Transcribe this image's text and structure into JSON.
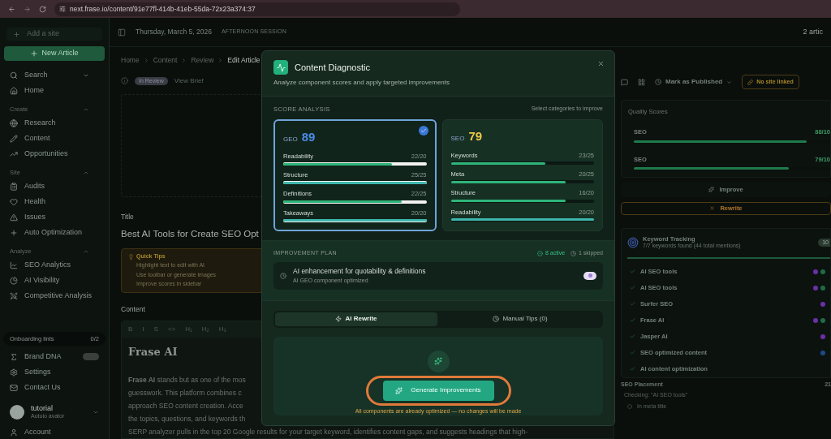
{
  "browser": {
    "url": "next.frase.io/content/91e77fl-414b-41eb-55da-72x23a374:37"
  },
  "sidebar": {
    "add_site": "Add a site",
    "new_article": "New Article",
    "search": "Search",
    "home": "Home",
    "sections": [
      {
        "title": "Create",
        "items": [
          {
            "label": "Research"
          },
          {
            "label": "Content"
          },
          {
            "label": "Opportunities"
          }
        ]
      },
      {
        "title": "Site",
        "items": [
          {
            "label": "Audits"
          },
          {
            "label": "Health"
          },
          {
            "label": "Issues"
          },
          {
            "label": "Auto Optimization"
          }
        ]
      },
      {
        "title": "Analyze",
        "items": [
          {
            "label": "SEO Analytics"
          },
          {
            "label": "AI Visibility"
          },
          {
            "label": "Competitive Analysis"
          }
        ]
      }
    ],
    "onboarding": {
      "label": "Onboarding lints",
      "count": "0/2"
    },
    "bottom_items": [
      {
        "label": "Brand DNA",
        "badge": true
      },
      {
        "label": "Settings",
        "badge": false
      },
      {
        "label": "Contact Us",
        "badge": false
      }
    ],
    "user": {
      "name": "tutorial",
      "subtitle": "Autuio avator"
    },
    "account": "Account"
  },
  "header": {
    "date": "Thursday, March 5, 2026",
    "session": "AFTERNOON SESSION",
    "count": "2 artic"
  },
  "breadcrumbs": [
    "Home",
    "Content",
    "Review",
    "Edit Article"
  ],
  "status": {
    "badge": "In Review",
    "link": "View Brief"
  },
  "title_field": {
    "label": "Title",
    "value": "Best AI Tools for Create SEO Opt"
  },
  "quick_tips": {
    "title": "Quick Tips",
    "tips": [
      "Highlight text to edit with AI",
      "Use toolbar or generate images",
      "Improve scores in sidebar"
    ]
  },
  "content": {
    "label": "Content",
    "toolbar": [
      "B",
      "I",
      "S",
      "<>",
      "H₁",
      "H₂",
      "H₃"
    ],
    "heading": "Frase AI",
    "lines": [
      "**Frase AI** stands but as one of the mos",
      "guesswork. This platform combines c",
      "approach SEO content creation. Acce",
      "the topics, questions, and keywords th"
    ],
    "last_line": "SERP analyzer pulls in the top 20 Google results for your target keyword, identifies content gaps, and suggests headings that high-"
  },
  "right_panel": {
    "publish": "Mark as Published",
    "site_link": "No site linked",
    "quality_title": "Quality Scores",
    "scores": [
      {
        "label": "SEO",
        "value": "88/10",
        "level": 0.88
      },
      {
        "label": "SEO",
        "value": "79/10",
        "level": 0.79
      }
    ],
    "improve": "Improve",
    "rewrite": "Rewrite",
    "keyword_tracking": {
      "title": "Keyword Tracking",
      "subtitle": "7/7 keywords found (44 total mentions)",
      "badge": "10",
      "keywords": [
        {
          "label": "AI SEO tools",
          "tags": [
            {
              "color": "#6b2fa8"
            },
            {
              "color": "#1e6b4a"
            }
          ]
        },
        {
          "label": "AI SEO tools",
          "tags": [
            {
              "color": "#6b2fa8"
            },
            {
              "color": "#1e6b4a"
            }
          ]
        },
        {
          "label": "Surfer SEO",
          "tags": [
            {
              "color": "#6b2fa8"
            }
          ]
        },
        {
          "label": "Frase AI",
          "tags": [
            {
              "color": "#6b2fa8"
            },
            {
              "color": "#1e6b4a"
            }
          ]
        },
        {
          "label": "Jasper AI",
          "tags": [
            {
              "color": "#6b2fa8"
            }
          ]
        },
        {
          "label": "SEO optimized content",
          "tags": [
            {
              "color": "#1e4a8a"
            }
          ]
        },
        {
          "label": "AI content optimization"
        }
      ]
    },
    "placement": {
      "title": "SEO Placement",
      "count": "21",
      "checking": "Checking: \"AI SEO tools\"",
      "item": "In meta title"
    }
  },
  "modal": {
    "title": "Content Diagnostic",
    "subtitle": "Analyze component scores and apply targeted improvements",
    "score_heading": "SCORE ANALYSIS",
    "score_hint": "Select categories to improve",
    "cards": [
      {
        "label": "GEO",
        "score": "89",
        "selected": true,
        "color": "#4a8de8",
        "metrics": [
          {
            "label": "Readability",
            "value": "22/20",
            "level": 0.76
          },
          {
            "label": "Structure",
            "value": "25/25",
            "level": 1
          },
          {
            "label": "Definitions",
            "value": "22/25",
            "level": 0.83
          },
          {
            "label": "Takeaways",
            "value": "20/20",
            "level": 1
          }
        ]
      },
      {
        "label": "SEO",
        "score": "79",
        "selected": false,
        "color": "#f0c94a",
        "metrics": [
          {
            "label": "Keywords",
            "value": "23/25",
            "level": 0.66
          },
          {
            "label": "Meta",
            "value": "20/25",
            "level": 0.8
          },
          {
            "label": "Structure",
            "value": "16/20",
            "level": 0.8
          },
          {
            "label": "Readability",
            "value": "20/20",
            "level": 1
          }
        ]
      }
    ],
    "plan_heading": "IMPROVEMENT PLAN",
    "active": "8 active",
    "skipped": "1 skipped",
    "plan_items": [
      {
        "title": "AI enhancement for quotability & definitions",
        "subtitle": "AI GEO component optimized",
        "on": false
      }
    ],
    "tabs": [
      {
        "label": "AI Rewrite",
        "selected": true
      },
      {
        "label": "Manual Tips (0)",
        "selected": false
      }
    ],
    "generate": "Generate Improvements",
    "highlighted": true,
    "note": "All components are already optimized — no changes will be made"
  }
}
